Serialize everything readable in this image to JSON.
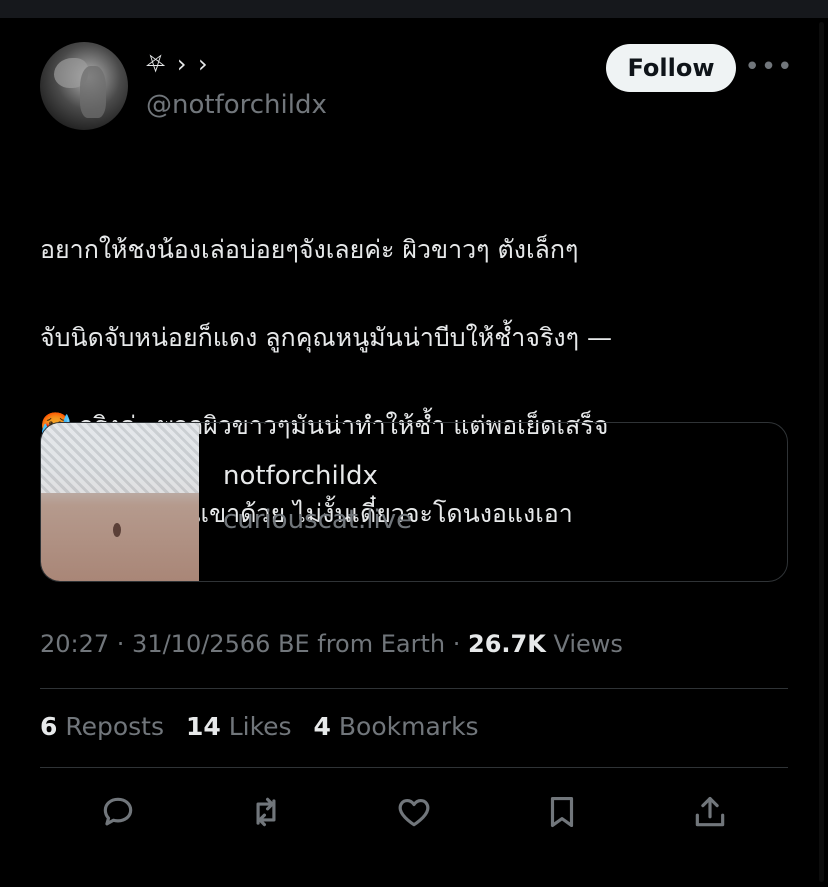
{
  "author": {
    "display_name": "⛧ › ›",
    "handle": "@notforchildx"
  },
  "header": {
    "follow_label": "Follow",
    "more_label": "•••"
  },
  "tweet": {
    "text_lines": [
      "อยากให้ชงน้องเล่อบ่อยๆจังเลยค่ะ ผิวขาวๆ ตังเล็กๆ",
      "จับนิดจับหน่อยก็แดง ลูกคุณหนูมันน่าบีบให้ช้ำจริงๆ —",
      "🥵 จริงค่ะ พวกผิวขาวๆมันน่าทำให้ช้ำ แต่พอเย็ดเสร็จ",
      "ก็ต้องโอ๋คุณหนูเขาด้วย ไม่งั้นเดี๋ยวจะโดนงอแงเอา"
    ]
  },
  "card": {
    "title": "notforchildx",
    "domain": "curiouscat.live"
  },
  "meta": {
    "timestamp": "20:27 · 31/10/2566 BE from Earth ·",
    "views_count": "26.7K",
    "views_label": "Views"
  },
  "stats": {
    "reposts_count": "6",
    "reposts_label": "Reposts",
    "likes_count": "14",
    "likes_label": "Likes",
    "bookmarks_count": "4",
    "bookmarks_label": "Bookmarks"
  },
  "actions": {
    "reply_icon": "reply-icon",
    "repost_icon": "repost-icon",
    "like_icon": "heart-icon",
    "bookmark_icon": "bookmark-icon",
    "share_icon": "share-icon"
  },
  "colors": {
    "background": "#000000",
    "text": "#e7e9ea",
    "secondary_text": "#71767b",
    "border": "#2f3336",
    "follow_bg": "#eff3f4"
  }
}
